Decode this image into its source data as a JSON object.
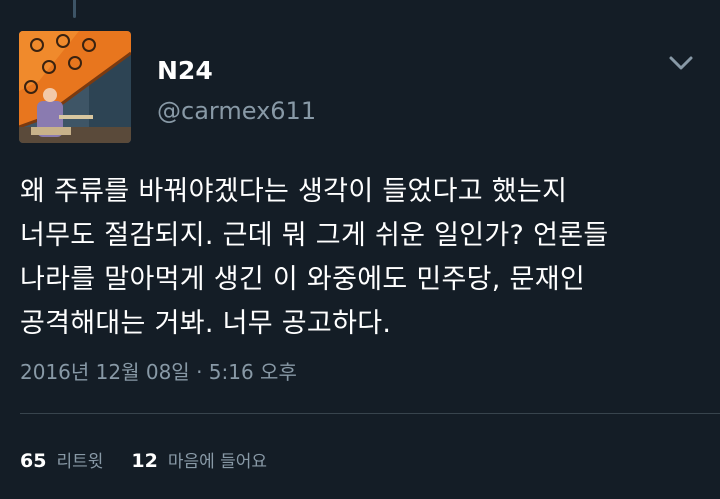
{
  "tweet": {
    "display_name": "N24",
    "handle": "@carmex611",
    "text_lines": [
      "왜 주류를 바꿔야겠다는 생각이 들었다고 했는지",
      "너무도 절감되지. 근데 뭐 그게 쉬운 일인가? 언론들",
      "나라를 말아먹게 생긴 이 와중에도 민주당, 문재인",
      "공격해대는 거봐. 너무 공고하다."
    ],
    "timestamp": "2016년 12월 08일 · 5:16 오후"
  },
  "stats": {
    "retweets": {
      "count": "65",
      "label": "리트윗"
    },
    "likes": {
      "count": "12",
      "label": "마음에 들어요"
    }
  },
  "icons": {
    "menu": "chevron-down-icon",
    "avatar": "avatar-image"
  },
  "colors": {
    "background": "#141d26",
    "secondary_text": "#8899a6",
    "divider": "#38444d"
  }
}
